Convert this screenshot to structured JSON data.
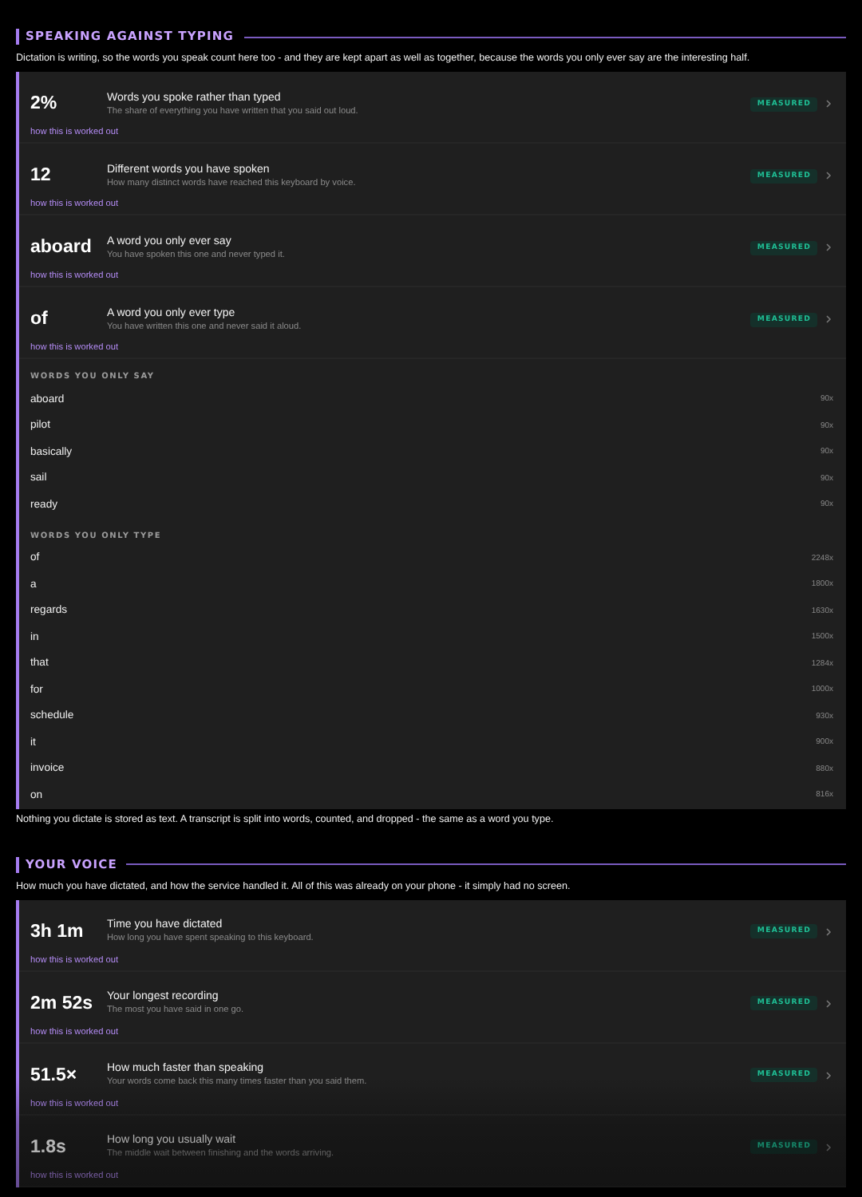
{
  "sections": [
    {
      "title": "SPEAKING AGAINST TYPING",
      "description": "Dictation is writing, so the words you speak count here too - and they are kept apart as well as together, because the words you only ever say are the interesting half.",
      "stats": [
        {
          "value": "2%",
          "title": "Words you spoke rather than typed",
          "subtitle": "The share of everything you have written that you said out loud.",
          "badge": "MEASURED",
          "link": "how this is worked out"
        },
        {
          "value": "12",
          "title": "Different words you have spoken",
          "subtitle": "How many distinct words have reached this keyboard by voice.",
          "badge": "MEASURED",
          "link": "how this is worked out"
        },
        {
          "value": "aboard",
          "title": "A word you only ever say",
          "subtitle": "You have spoken this one and never typed it.",
          "badge": "MEASURED",
          "link": "how this is worked out"
        },
        {
          "value": "of",
          "title": "A word you only ever type",
          "subtitle": "You have written this one and never said it aloud.",
          "badge": "MEASURED",
          "link": "how this is worked out"
        }
      ],
      "word_lists": [
        {
          "heading": "WORDS YOU ONLY SAY",
          "words": [
            {
              "word": "aboard",
              "count": "90x"
            },
            {
              "word": "pilot",
              "count": "90x"
            },
            {
              "word": "basically",
              "count": "90x"
            },
            {
              "word": "sail",
              "count": "90x"
            },
            {
              "word": "ready",
              "count": "90x"
            }
          ]
        },
        {
          "heading": "WORDS YOU ONLY TYPE",
          "words": [
            {
              "word": "of",
              "count": "2248x"
            },
            {
              "word": "a",
              "count": "1800x"
            },
            {
              "word": "regards",
              "count": "1630x"
            },
            {
              "word": "in",
              "count": "1500x"
            },
            {
              "word": "that",
              "count": "1284x"
            },
            {
              "word": "for",
              "count": "1000x"
            },
            {
              "word": "schedule",
              "count": "930x"
            },
            {
              "word": "it",
              "count": "900x"
            },
            {
              "word": "invoice",
              "count": "880x"
            },
            {
              "word": "on",
              "count": "816x"
            }
          ]
        }
      ],
      "footnote": "Nothing you dictate is stored as text. A transcript is split into words, counted, and dropped - the same as a word you type."
    },
    {
      "title": "YOUR VOICE",
      "description": "How much you have dictated, and how the service handled it. All of this was already on your phone - it simply had no screen.",
      "stats": [
        {
          "value": "3h 1m",
          "title": "Time you have dictated",
          "subtitle": "How long you have spent speaking to this keyboard.",
          "badge": "MEASURED",
          "link": "how this is worked out"
        },
        {
          "value": "2m 52s",
          "title": "Your longest recording",
          "subtitle": "The most you have said in one go.",
          "badge": "MEASURED",
          "link": "how this is worked out"
        },
        {
          "value": "51.5×",
          "title": "How much faster than speaking",
          "subtitle": "Your words come back this many times faster than you said them.",
          "badge": "MEASURED",
          "link": "how this is worked out"
        },
        {
          "value": "1.8s",
          "title": "How long you usually wait",
          "subtitle": "The middle wait between finishing and the words arriving.",
          "badge": "MEASURED",
          "link": "how this is worked out"
        }
      ]
    }
  ]
}
